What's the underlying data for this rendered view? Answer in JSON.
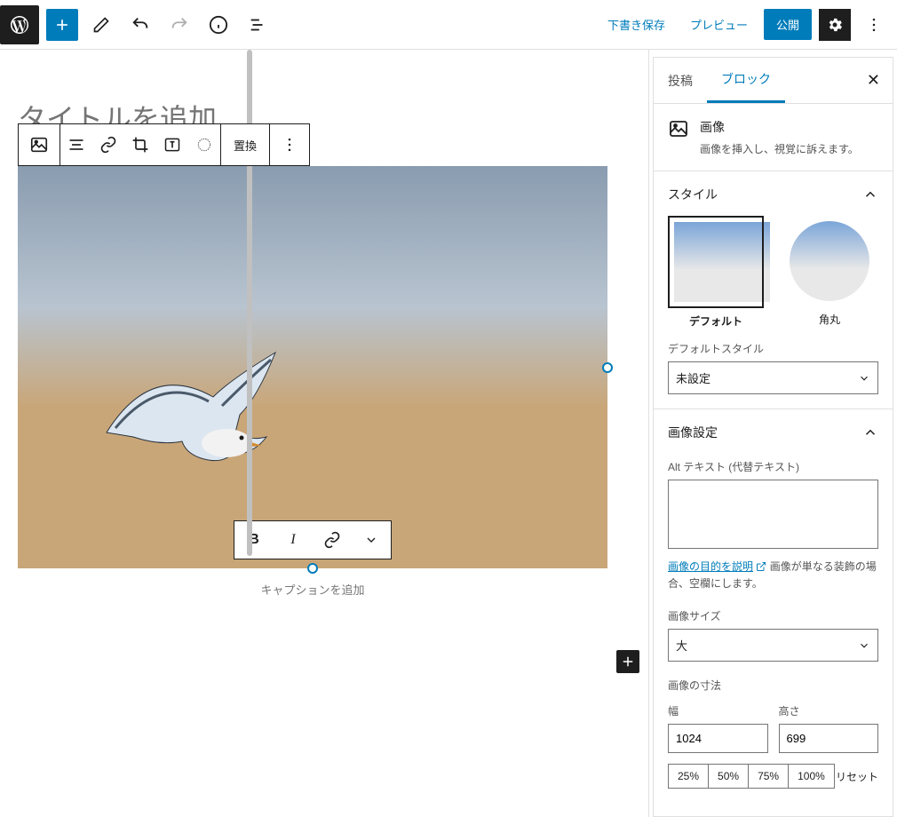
{
  "topbar": {
    "save_draft": "下書き保存",
    "preview": "プレビュー",
    "publish": "公開"
  },
  "editor": {
    "title_placeholder": "タイトルを追加",
    "caption_placeholder": "キャプションを追加",
    "block_toolbar": {
      "replace": "置換"
    }
  },
  "sidebar": {
    "tabs": {
      "post": "投稿",
      "block": "ブロック"
    },
    "block_card": {
      "title": "画像",
      "desc": "画像を挿入し、視覚に訴えます。"
    },
    "style_panel": {
      "heading": "スタイル",
      "default": "デフォルト",
      "rounded": "角丸",
      "default_style_label": "デフォルトスタイル",
      "default_style_value": "未設定"
    },
    "image_settings": {
      "heading": "画像設定",
      "alt_label": "Alt テキスト (代替テキスト)",
      "help_link": "画像の目的を説明",
      "help_rest": "画像が単なる装飾の場合、空欄にします。",
      "size_label": "画像サイズ",
      "size_value": "大",
      "dimensions_label": "画像の寸法",
      "width_label": "幅",
      "height_label": "高さ",
      "width_value": "1024",
      "height_value": "699",
      "p25": "25%",
      "p50": "50%",
      "p75": "75%",
      "p100": "100%",
      "reset": "リセット"
    }
  }
}
